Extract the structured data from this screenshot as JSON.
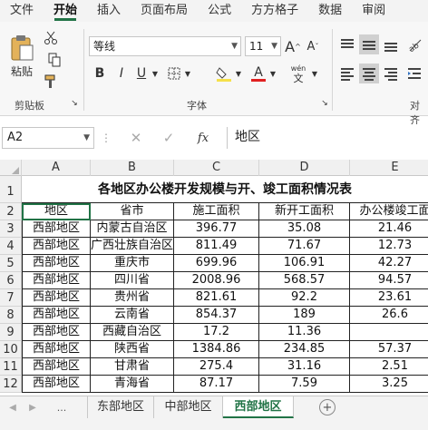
{
  "ribbon_tabs": [
    "文件",
    "开始",
    "插入",
    "页面布局",
    "公式",
    "方方格子",
    "数据",
    "审阅"
  ],
  "ribbon": {
    "paste_label": "粘贴",
    "clipboard_label": "剪贴板",
    "font_name": "等线",
    "font_size": "11",
    "font_group_label": "字体",
    "align_group_label": "对齐",
    "bold": "B",
    "italic": "I",
    "underline": "U",
    "grow_font": "A",
    "shrink_font": "A",
    "font_color_glyph": "A",
    "wen_top": "wén",
    "wen_bottom": "文"
  },
  "formula_bar": {
    "name_box": "A2",
    "fx": "fx",
    "value": "地区"
  },
  "columns": [
    "A",
    "B",
    "C",
    "D",
    "E"
  ],
  "rows": [
    "1",
    "2",
    "3",
    "4",
    "5",
    "6",
    "7",
    "8",
    "9",
    "10",
    "11",
    "12"
  ],
  "sheet": {
    "title": "各地区办公楼开发规模与开、竣工面积情况表",
    "headers": [
      "地区",
      "省市",
      "施工面积",
      "新开工面积",
      "办公楼竣工面"
    ],
    "data": [
      [
        "西部地区",
        "内蒙古自治区",
        "396.77",
        "35.08",
        "21.46"
      ],
      [
        "西部地区",
        "广西壮族自治区",
        "811.49",
        "71.67",
        "12.73"
      ],
      [
        "西部地区",
        "重庆市",
        "699.96",
        "106.91",
        "42.27"
      ],
      [
        "西部地区",
        "四川省",
        "2008.96",
        "568.57",
        "94.57"
      ],
      [
        "西部地区",
        "贵州省",
        "821.61",
        "92.2",
        "23.61"
      ],
      [
        "西部地区",
        "云南省",
        "854.37",
        "189",
        "26.6"
      ],
      [
        "西部地区",
        "西藏自治区",
        "17.2",
        "11.36",
        ""
      ],
      [
        "西部地区",
        "陕西省",
        "1384.86",
        "234.85",
        "57.37"
      ],
      [
        "西部地区",
        "甘肃省",
        "275.4",
        "31.16",
        "2.51"
      ],
      [
        "西部地区",
        "青海省",
        "87.17",
        "7.59",
        "3.25"
      ]
    ]
  },
  "sheet_tabs": [
    "东部地区",
    "中部地区",
    "西部地区"
  ],
  "active_sheet": "西部地区",
  "colors": {
    "accent": "#217346",
    "font_color": "#e02020",
    "fill_color": "#f5e04a"
  }
}
